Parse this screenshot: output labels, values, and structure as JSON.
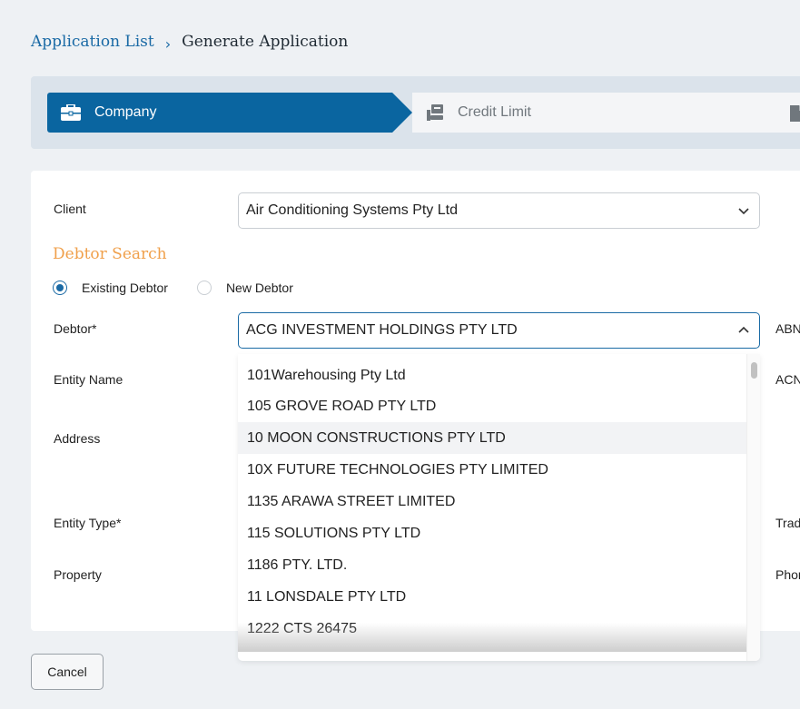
{
  "breadcrumb": {
    "parent": "Application List",
    "current": "Generate Application"
  },
  "stepper": {
    "steps": [
      {
        "label": "Company",
        "icon": "briefcase-icon",
        "active": true
      },
      {
        "label": "Credit Limit",
        "icon": "credit-limit-icon",
        "active": false
      },
      {
        "label": "",
        "icon": "document-icon",
        "active": false
      }
    ]
  },
  "form": {
    "client_label": "Client",
    "client_value": "Air Conditioning Systems Pty Ltd",
    "section_title": "Debtor Search",
    "radio_existing": "Existing Debtor",
    "radio_new": "New Debtor",
    "debtor_label": "Debtor*",
    "debtor_value": "ACG INVESTMENT HOLDINGS PTY LTD",
    "entity_name_label": "Entity Name",
    "address_label": "Address",
    "entity_type_label": "Entity Type*",
    "property_label": "Property",
    "right_labels": [
      "ABN",
      "ACN",
      "Trad",
      "Phon"
    ]
  },
  "dropdown": {
    "items": [
      "101Warehousing Pty Ltd",
      "105 GROVE ROAD PTY LTD",
      "10 MOON CONSTRUCTIONS PTY LTD",
      "10X FUTURE TECHNOLOGIES PTY LIMITED",
      "1135 ARAWA STREET LIMITED",
      "115 SOLUTIONS PTY LTD",
      "1186 PTY. LTD.",
      "11 LONSDALE PTY LTD",
      "1222 CTS 26475"
    ],
    "hovered_index": 2
  },
  "actions": {
    "cancel_label": "Cancel"
  },
  "colors": {
    "accent": "#0a65a0",
    "section_title": "#f0a04b",
    "link": "#1a6aa5"
  }
}
